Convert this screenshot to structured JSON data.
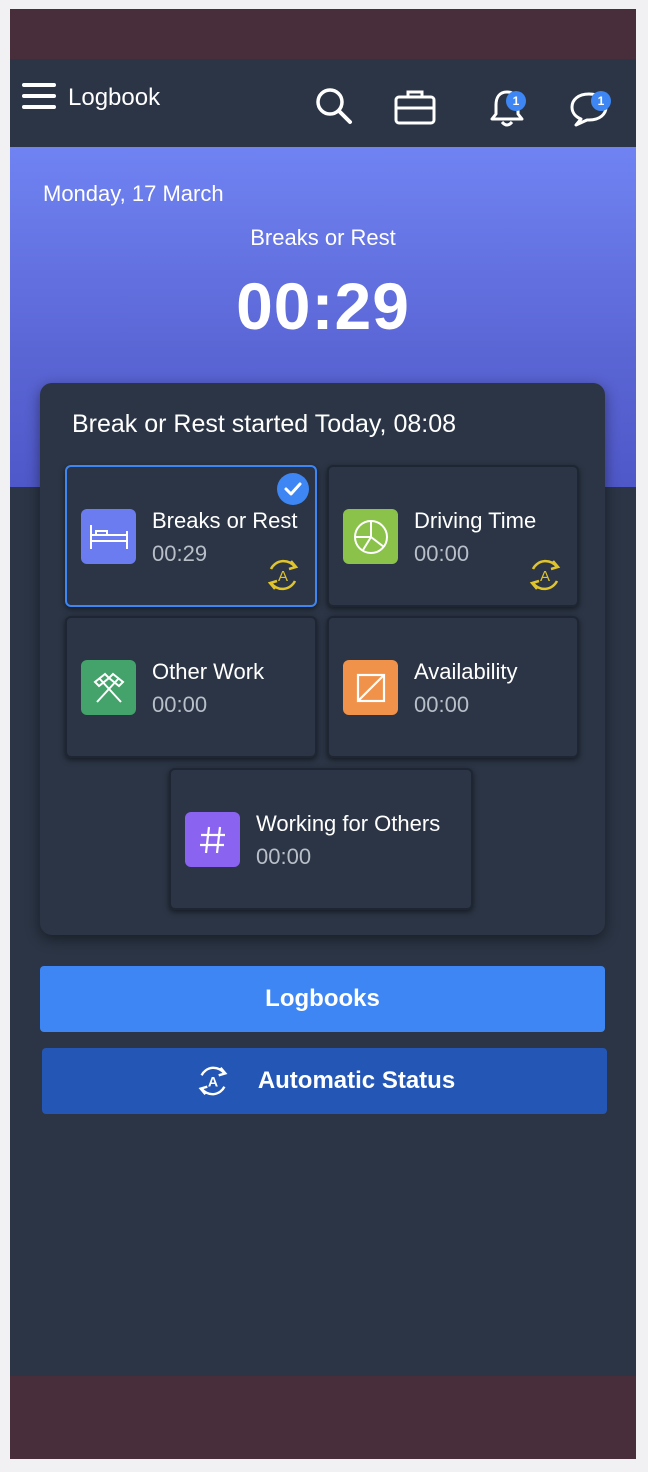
{
  "nav": {
    "title": "Logbook",
    "icons": [
      "menu-icon",
      "search-icon",
      "briefcase-icon",
      "bell-icon",
      "chat-icon"
    ],
    "notifications_badge": "1",
    "messages_badge": "1"
  },
  "hero": {
    "date": "Monday, 17 March",
    "status": "Breaks or Rest",
    "timer": "00:29"
  },
  "card": {
    "title": "Break or Rest started Today, 08:08",
    "tiles": [
      {
        "label": "Breaks or Rest",
        "time": "00:29",
        "icon": "bed-icon",
        "color": "#6a7cf0",
        "selected": true,
        "auto": true
      },
      {
        "label": "Driving Time",
        "time": "00:00",
        "icon": "steering-wheel-icon",
        "color": "#8bc34a",
        "selected": false,
        "auto": true
      },
      {
        "label": "Other Work",
        "time": "00:00",
        "icon": "hammers-icon",
        "color": "#43a36b",
        "selected": false,
        "auto": false
      },
      {
        "label": "Availability",
        "time": "00:00",
        "icon": "availability-icon",
        "color": "#f0924a",
        "selected": false,
        "auto": false
      },
      {
        "label": "Working for Others",
        "time": "00:00",
        "icon": "hash-icon",
        "color": "#8a63f0",
        "selected": false,
        "auto": false
      }
    ]
  },
  "buttons": {
    "logbooks": "Logbooks",
    "automatic_status": "Automatic Status"
  },
  "colors": {
    "accent": "#3d86f3",
    "auto_icon": "#e0c42a"
  }
}
